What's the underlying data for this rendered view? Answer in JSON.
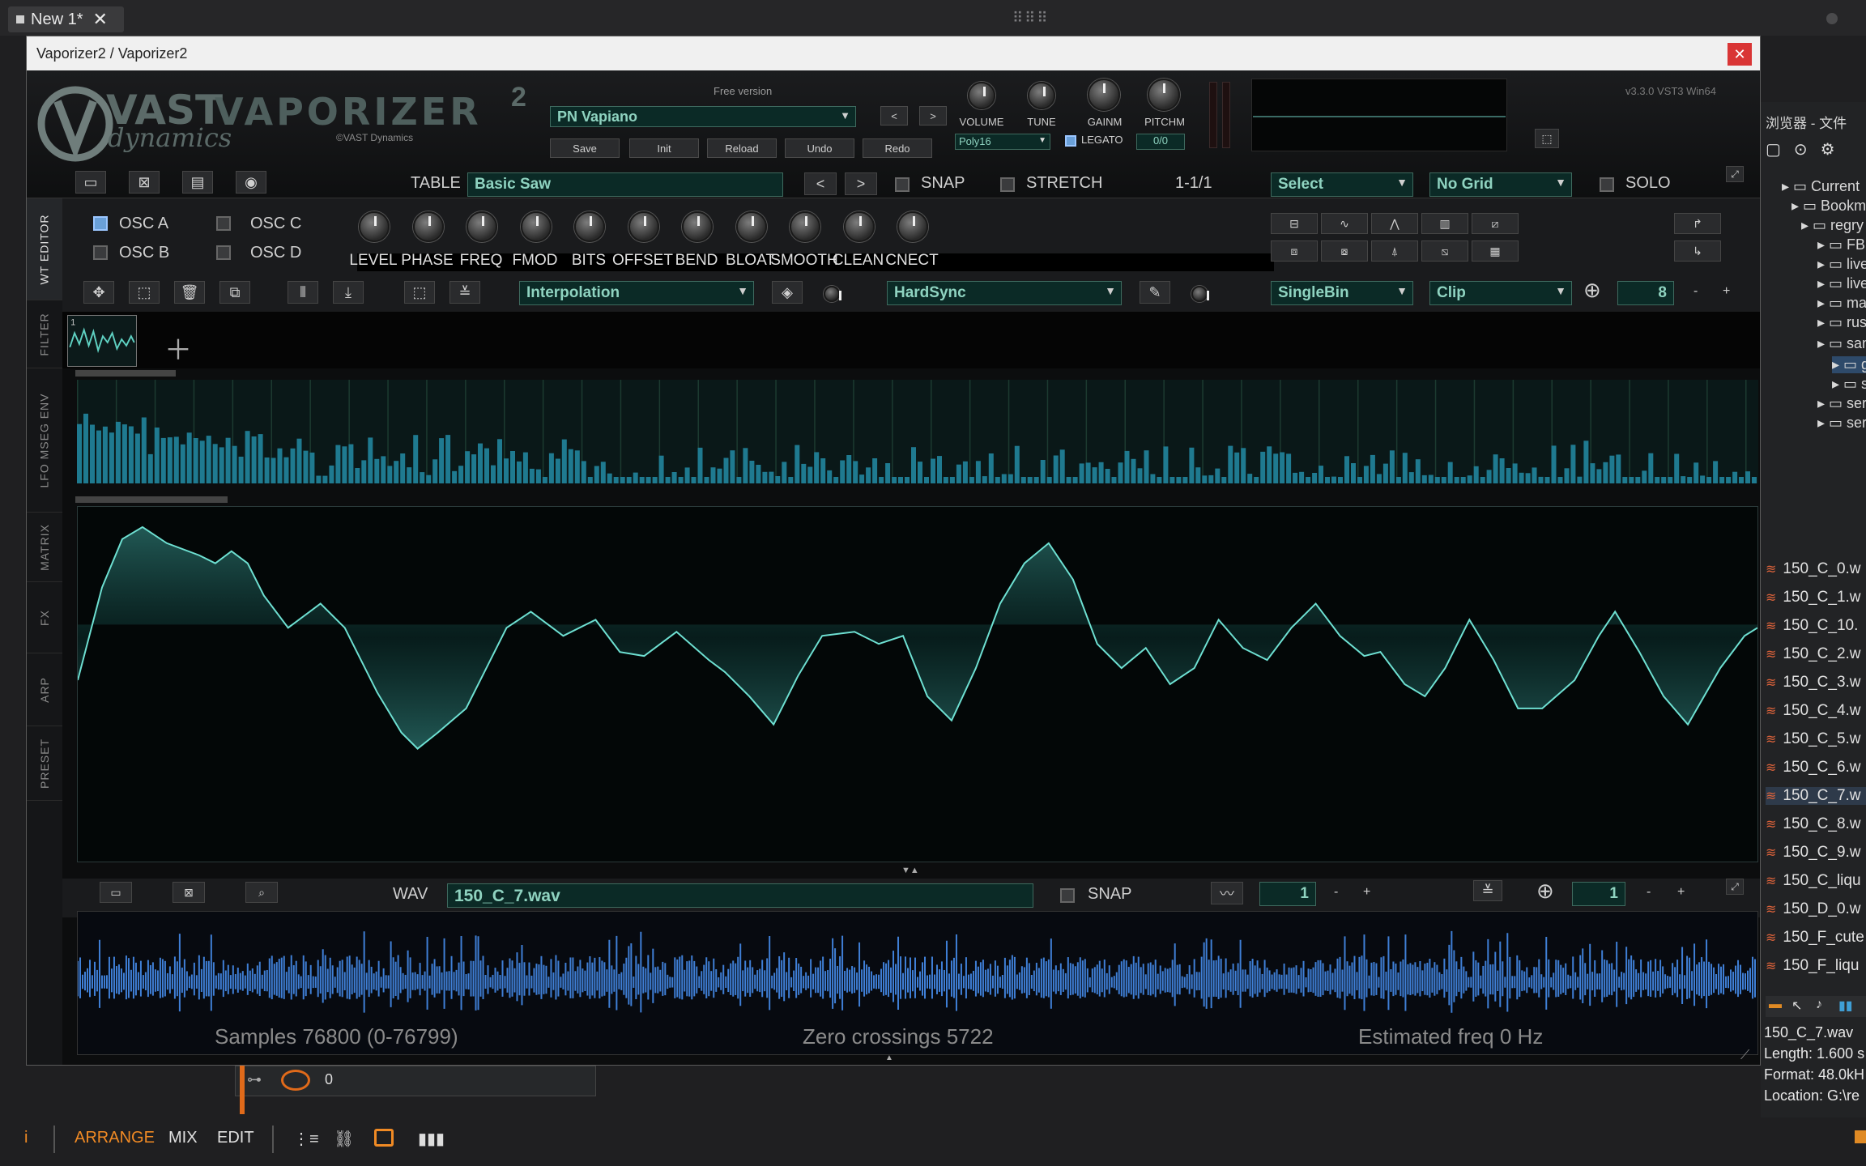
{
  "daw": {
    "tab_title": "New 1*",
    "tab_close": "✕",
    "bottom_tabs": [
      "ARRANGE",
      "MIX",
      "EDIT"
    ],
    "clip_value": "0"
  },
  "plugin": {
    "window_title": "Vaporizer2 / Vaporizer2",
    "close": "✕",
    "logo_brand": "VAST",
    "logo_name": "VAPORIZER",
    "logo_sup": "2",
    "logo_sub": "dynamics",
    "copyright": "©VAST Dynamics",
    "free_version": "Free version",
    "version": "v3.3.0 VST3 Win64",
    "preset": "PN Vapiano",
    "preset_prev": "<",
    "preset_next": ">",
    "buttons": [
      "Save",
      "Init",
      "Reload",
      "Undo",
      "Redo"
    ],
    "header_knobs": [
      "VOLUME",
      "TUNE",
      "GAINM",
      "PITCHM"
    ],
    "poly": "Poly16",
    "legato": "LEGATO",
    "voices": "0/0",
    "side_tabs": [
      "WT EDITOR",
      "FILTER",
      "LFO MSEG ENV",
      "MATRIX",
      "FX",
      "ARP",
      "PRESET"
    ]
  },
  "wt_editor": {
    "table_label": "TABLE",
    "table_value": "Basic Saw",
    "nav_prev": "<",
    "nav_next": ">",
    "snap": "SNAP",
    "stretch": "STRETCH",
    "position": "1-1/1",
    "select": "Select",
    "grid": "No Grid",
    "solo": "SOLO",
    "osc": [
      "OSC A",
      "OSC B",
      "OSC C",
      "OSC D"
    ],
    "osc_checked": [
      true,
      false,
      false,
      false
    ],
    "knobs": [
      "LEVEL",
      "PHASE",
      "FREQ",
      "FMOD",
      "BITS",
      "OFFSET",
      "BEND",
      "BLOAT",
      "SMOOTH",
      "CLEAN",
      "CNECT"
    ],
    "interpolation": "Interpolation",
    "hardsync": "HardSync",
    "singlebin": "SingleBin",
    "clip": "Clip",
    "zoom_value": "8",
    "minus": "-",
    "plus": "+"
  },
  "wav": {
    "label": "WAV",
    "file": "150_C_7.wav",
    "snap": "SNAP",
    "value_a": "1",
    "value_b": "1",
    "minus": "-",
    "plus": "+",
    "samples": "Samples 76800 (0-76799)",
    "zero_crossings": "Zero crossings 5722",
    "est_freq": "Estimated freq 0 Hz"
  },
  "browser": {
    "title": "浏览器 - 文件",
    "tree": [
      "Current",
      "Bookma",
      "regry",
      "FB p",
      "liveI",
      "liveT",
      "mas",
      "rust",
      "sam",
      "gr",
      "st",
      "seru",
      "seru"
    ],
    "files": [
      "150_C_0.w",
      "150_C_1.w",
      "150_C_10.",
      "150_C_2.w",
      "150_C_3.w",
      "150_C_4.w",
      "150_C_5.w",
      "150_C_6.w",
      "150_C_7.w",
      "150_C_8.w",
      "150_C_9.w",
      "150_C_liqu",
      "150_D_0.w",
      "150_F_cute",
      "150_F_liqu"
    ],
    "selected_file": "150_C_7.wav",
    "length": "Length: 1.600 s",
    "format": "Format: 48.0kH",
    "location": "Location: G:\\re"
  },
  "colors": {
    "accent": "#f08a24",
    "teal": "#8fd3c0",
    "wave": "#5fd1c2",
    "wav_blue": "#3f7fd6"
  }
}
